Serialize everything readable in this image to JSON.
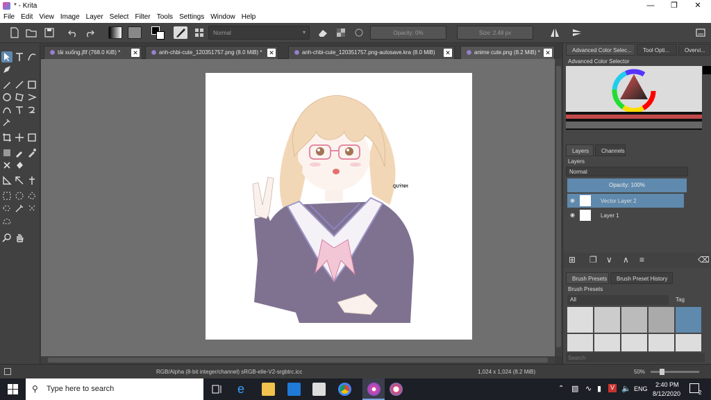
{
  "window": {
    "title": "* - Krita"
  },
  "menu": [
    "File",
    "Edit",
    "View",
    "Image",
    "Layer",
    "Select",
    "Filter",
    "Tools",
    "Settings",
    "Window",
    "Help"
  ],
  "toolbar": {
    "blend_mode": "Normal",
    "opacity": "Opacity: 0%",
    "size": "Size: 2.48 px"
  },
  "tabs": [
    {
      "label": "tải xuống.jfif (768.0 KiB) *"
    },
    {
      "label": "anh-chbi-cute_120351757.png (8.0 MiB) *"
    },
    {
      "label": "anh-chbi-cute_120351757.png-autosave.kra (8.0 MiB)"
    },
    {
      "label": "anime cute.png (8.2 MiB) *"
    }
  ],
  "canvas": {
    "signature": "QUỲNH"
  },
  "dock": {
    "top_tabs": [
      "Advanced Color Selec...",
      "Tool Opti...",
      "Overvi..."
    ],
    "color_selector_title": "Advanced Color Selector",
    "layer_tabs": [
      "Layers",
      "Channels"
    ],
    "layers_title": "Layers",
    "layer_blend": "Normal",
    "layer_opacity": "Opacity:  100%",
    "layers": [
      {
        "name": "Vector Layer 2",
        "selected": true
      },
      {
        "name": "Layer 1",
        "selected": false
      }
    ],
    "brush_tabs": [
      "Brush Presets",
      "Brush Preset History"
    ],
    "brush_title": "Brush Presets",
    "brush_filter": "All",
    "brush_tag": "Tag",
    "brush_search_placeholder": "Search"
  },
  "status": {
    "color_profile": "RGB/Alpha (8-bit integer/channel)  sRGB-elle-V2-srgbtrc.icc",
    "dimensions": "1,024 x 1,024 (8.2 MiB)",
    "zoom": "50%"
  },
  "taskbar": {
    "search_placeholder": "Type here to search",
    "language": "ENG",
    "time": "2:40 PM",
    "date": "8/12/2020",
    "notifications": "2"
  },
  "colors": {
    "accent": "#5f89ad",
    "canvas_bg": "#6f6f6f",
    "panel": "#464646"
  }
}
